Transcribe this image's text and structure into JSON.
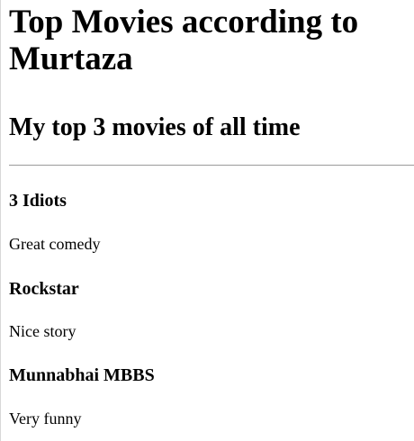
{
  "header": {
    "title": "Top Movies according to Murtaza",
    "subtitle": "My top 3 movies of all time"
  },
  "movies": [
    {
      "name": "3 Idiots",
      "description": "Great comedy"
    },
    {
      "name": "Rockstar",
      "description": "Nice story"
    },
    {
      "name": "Munnabhai MBBS",
      "description": "Very funny"
    }
  ]
}
